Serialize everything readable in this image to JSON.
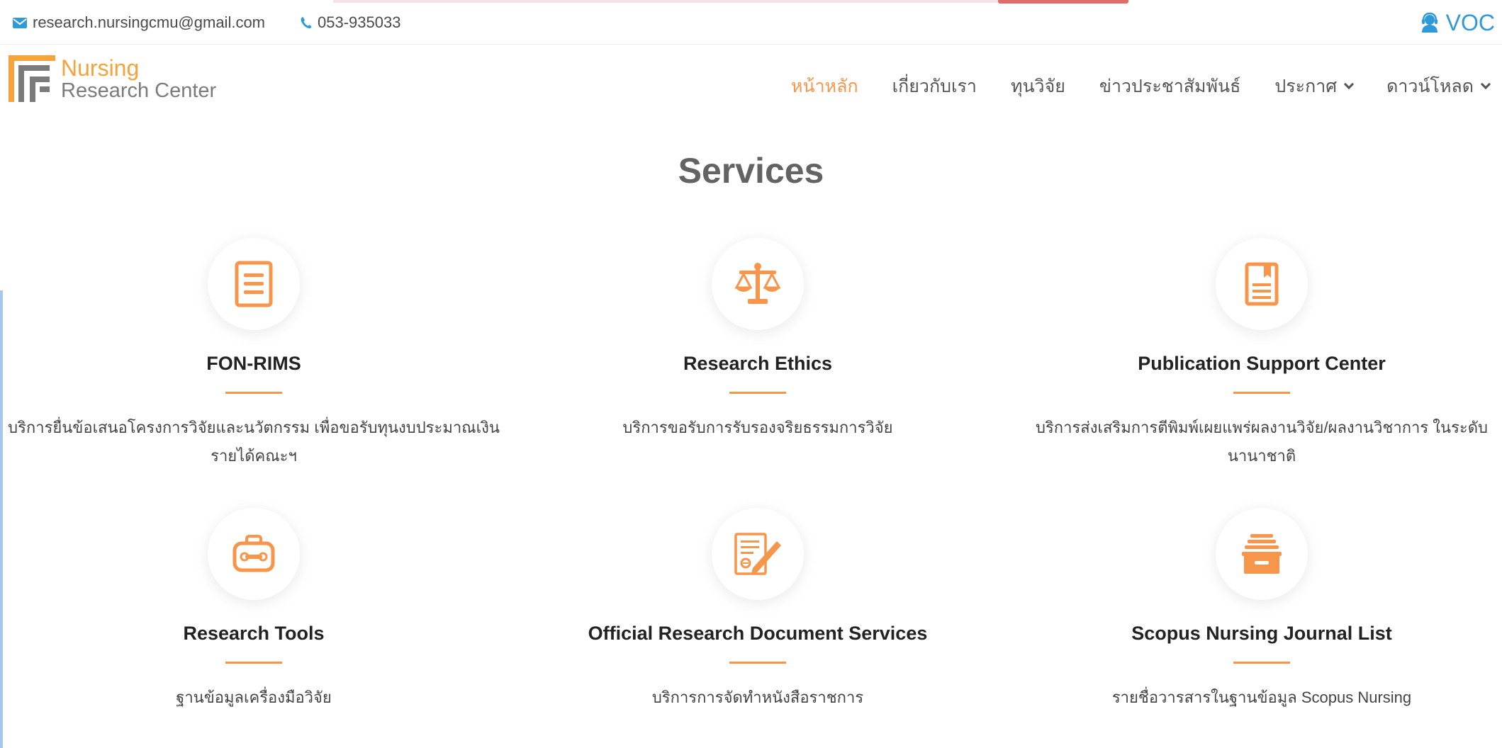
{
  "topbar": {
    "email": "research.nursingcmu@gmail.com",
    "phone": "053-935033",
    "voc_label": "VOC"
  },
  "logo": {
    "line1": "Nursing",
    "line2": "Research Center"
  },
  "nav": {
    "items": [
      {
        "label": "หน้าหลัก",
        "active": true
      },
      {
        "label": "เกี่ยวกับเรา"
      },
      {
        "label": "ทุนวิจัย"
      },
      {
        "label": "ข่าวประชาสัมพันธ์"
      },
      {
        "label": "ประกาศ"
      },
      {
        "label": "ดาวน์โหลด"
      }
    ]
  },
  "services": {
    "title": "Services",
    "items": [
      {
        "title": "FON-RIMS",
        "desc": "บริการยื่นข้อเสนอโครงการวิจัยและนวัตกรรม เพื่อขอรับทุนงบประมาณเงินรายได้คณะฯ",
        "icon": "document-icon"
      },
      {
        "title": "Research Ethics",
        "desc": "บริการขอรับการรับรองจริยธรรมการวิจัย",
        "icon": "scales-icon"
      },
      {
        "title": "Publication Support Center",
        "desc": "บริการส่งเสริมการตีพิมพ์เผยแพร่ผลงานวิจัย/ผลงานวิชาการ ในระดับนานาชาติ",
        "icon": "bookmark-document-icon"
      },
      {
        "title": "Research Tools",
        "desc": "ฐานข้อมูลเครื่องมือวิจัย",
        "icon": "toolbox-icon"
      },
      {
        "title": "Official Research Document Services",
        "desc": "บริการการจัดทำหนังสือราชการ",
        "icon": "signing-document-icon"
      },
      {
        "title": "Scopus Nursing Journal List",
        "desc": "รายชื่อวารสารในฐานข้อมูล Scopus Nursing",
        "icon": "archive-icon"
      }
    ]
  },
  "colors": {
    "accent": "#f7964a",
    "voc": "#2f9ad8",
    "logo_orange": "#f7a33b"
  }
}
